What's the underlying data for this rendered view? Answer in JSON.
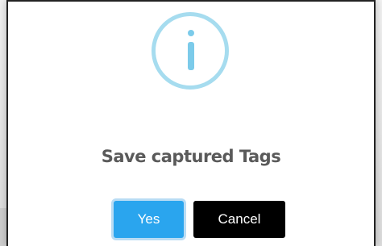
{
  "dialog": {
    "icon": "info-icon",
    "title": "Save captured Tags",
    "yes_label": "Yes",
    "cancel_label": "Cancel"
  },
  "colors": {
    "icon_ring": "#a6dcef",
    "icon_glyph": "#7ccbea",
    "yes_button": "#2aa5ee",
    "cancel_button": "#000000",
    "title_text": "#5a5a5a"
  }
}
